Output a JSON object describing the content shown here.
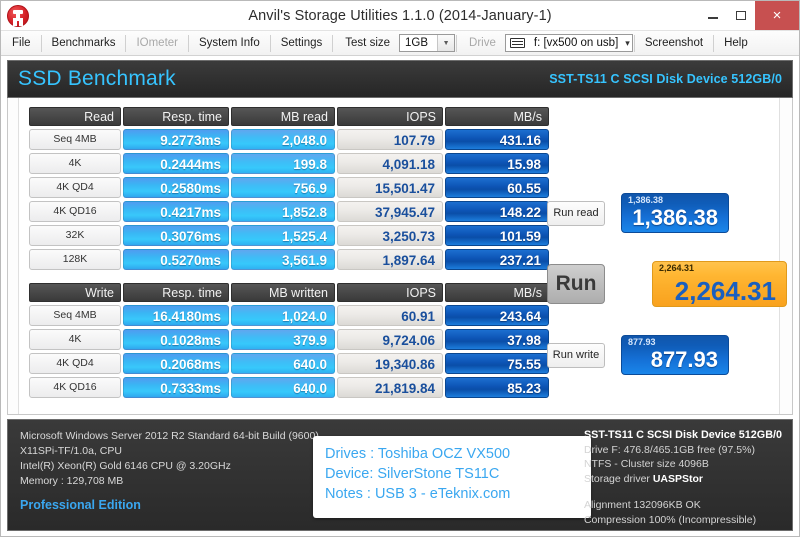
{
  "window": {
    "title": "Anvil's Storage Utilities 1.1.0 (2014-January-1)",
    "app_icon": "anvil-icon",
    "minimize_label": "",
    "maximize_label": "",
    "close_label": "×",
    "close_color": "#c75050"
  },
  "toolbar": {
    "file": "File",
    "benchmarks": "Benchmarks",
    "iometer": "IOmeter",
    "system_info": "System Info",
    "settings": "Settings",
    "test_size_label": "Test size",
    "test_size_value": "1GB",
    "drive_label": "Drive",
    "drive_value": "f: [vx500 on usb]",
    "screenshot": "Screenshot",
    "help": "Help"
  },
  "band": {
    "title": "SSD Benchmark",
    "device": "SST-TS11 C SCSI Disk Device 512GB/0",
    "accent": "#36c4ff"
  },
  "read_table": {
    "headers": [
      "Read",
      "Resp. time",
      "MB read",
      "IOPS",
      "MB/s"
    ],
    "rows": [
      {
        "label": "Seq 4MB",
        "resp": "9.2773ms",
        "mb": "2,048.0",
        "iops": "107.79",
        "mbs": "431.16"
      },
      {
        "label": "4K",
        "resp": "0.2444ms",
        "mb": "199.8",
        "iops": "4,091.18",
        "mbs": "15.98"
      },
      {
        "label": "4K QD4",
        "resp": "0.2580ms",
        "mb": "756.9",
        "iops": "15,501.47",
        "mbs": "60.55"
      },
      {
        "label": "4K QD16",
        "resp": "0.4217ms",
        "mb": "1,852.8",
        "iops": "37,945.47",
        "mbs": "148.22"
      },
      {
        "label": "32K",
        "resp": "0.3076ms",
        "mb": "1,525.4",
        "iops": "3,250.73",
        "mbs": "101.59"
      },
      {
        "label": "128K",
        "resp": "0.5270ms",
        "mb": "3,561.9",
        "iops": "1,897.64",
        "mbs": "237.21"
      }
    ]
  },
  "write_table": {
    "headers": [
      "Write",
      "Resp. time",
      "MB written",
      "IOPS",
      "MB/s"
    ],
    "rows": [
      {
        "label": "Seq 4MB",
        "resp": "16.4180ms",
        "mb": "1,024.0",
        "iops": "60.91",
        "mbs": "243.64"
      },
      {
        "label": "4K",
        "resp": "0.1028ms",
        "mb": "379.9",
        "iops": "9,724.06",
        "mbs": "37.98"
      },
      {
        "label": "4K QD4",
        "resp": "0.2068ms",
        "mb": "640.0",
        "iops": "19,340.86",
        "mbs": "75.55"
      },
      {
        "label": "4K QD16",
        "resp": "0.7333ms",
        "mb": "640.0",
        "iops": "21,819.84",
        "mbs": "85.23"
      }
    ]
  },
  "scores": {
    "run_read_label": "Run read",
    "run_label": "Run",
    "run_write_label": "Run write",
    "read_score_small": "1,386.38",
    "read_score": "1,386.38",
    "total_score_small": "2,264.31",
    "total_score": "2,264.31",
    "write_score_small": "877.93",
    "write_score": "877.93",
    "read_color": "#1570d6",
    "total_color": "#ffb733",
    "write_color": "#1570d6"
  },
  "footer": {
    "system": [
      "Microsoft Windows Server 2012 R2 Standard 64-bit Build (9600)",
      "X11SPi-TF/1.0a, CPU",
      "Intel(R) Xeon(R) Gold 6146 CPU @ 3.20GHz",
      "Memory : 129,708 MB"
    ],
    "edition": "Professional Edition",
    "notes": [
      "Drives : Toshiba OCZ VX500",
      "Device: SilverStone TS11C",
      "Notes : USB 3 - eTeknix.com"
    ],
    "drive_info": {
      "device": "SST-TS11 C SCSI Disk Device 512GB/0",
      "capacity": "Drive F: 476.8/465.1GB free (97.5%)",
      "filesystem": "NTFS - Cluster size 4096B",
      "driver_label": "Storage driver",
      "driver_value": "UASPStor",
      "alignment": "Alignment 132096KB OK",
      "compression": "Compression 100% (Incompressible)"
    }
  }
}
